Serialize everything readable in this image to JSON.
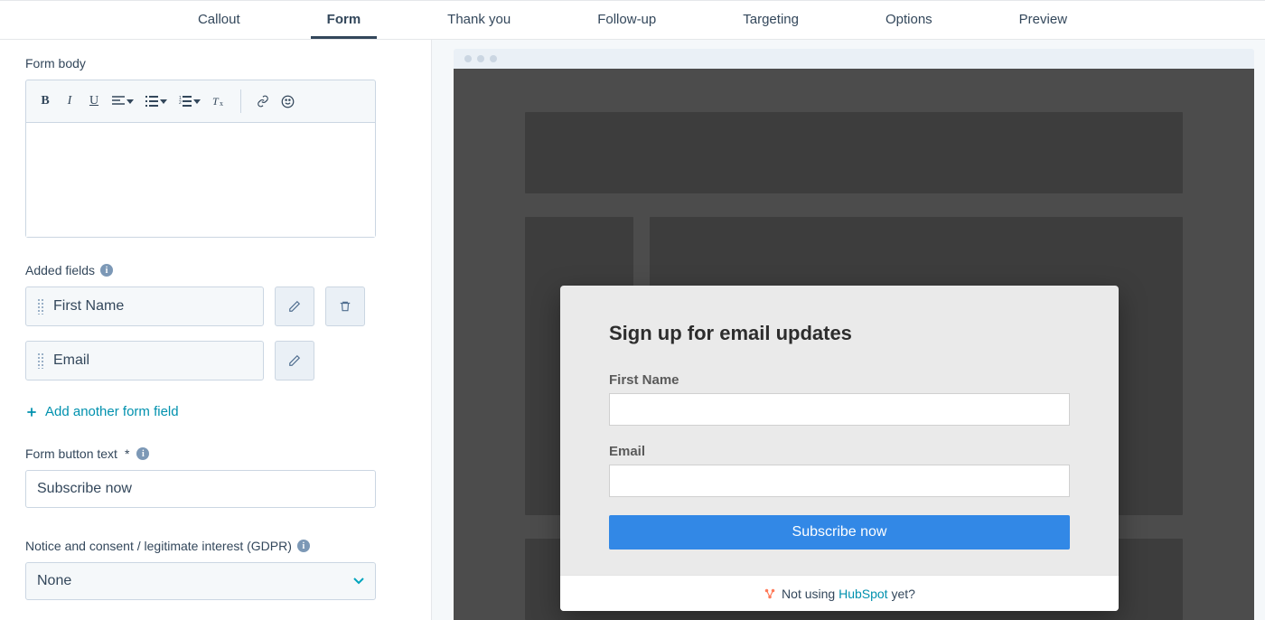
{
  "tabs": {
    "items": [
      "Callout",
      "Form",
      "Thank you",
      "Follow-up",
      "Targeting",
      "Options",
      "Preview"
    ],
    "active_index": 1
  },
  "left": {
    "form_body_label": "Form body",
    "added_fields_label": "Added fields",
    "fields": [
      {
        "label": "First Name",
        "deletable": true
      },
      {
        "label": "Email",
        "deletable": false
      }
    ],
    "add_field_label": "Add another form field",
    "button_text_label": "Form button text",
    "button_text_value": "Subscribe now",
    "gdpr_label": "Notice and consent / legitimate interest (GDPR)",
    "gdpr_selected": "None"
  },
  "preview": {
    "popup_title": "Sign up for email updates",
    "field1_label": "First Name",
    "field2_label": "Email",
    "submit_label": "Subscribe now",
    "footer_prefix": "Not using ",
    "footer_brand": "HubSpot",
    "footer_suffix": " yet?"
  }
}
